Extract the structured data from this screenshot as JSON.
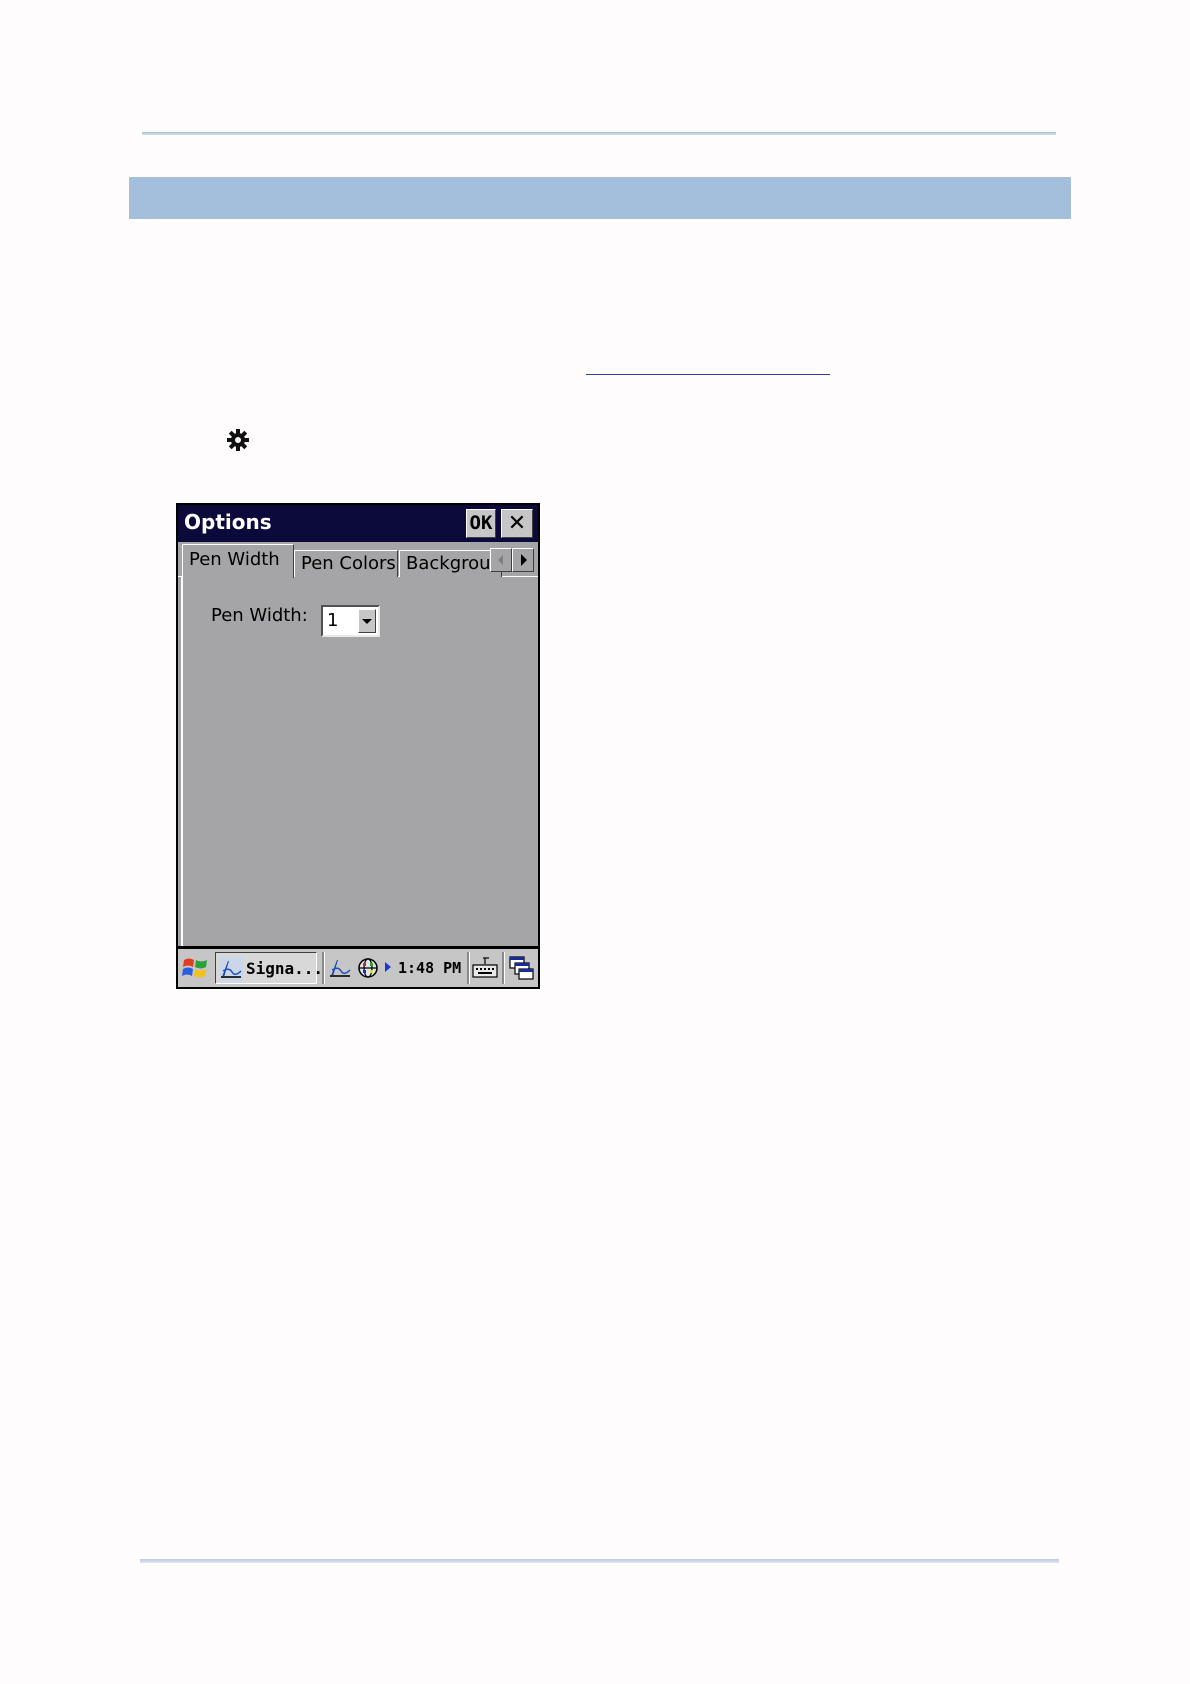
{
  "dialog": {
    "title": "Options",
    "ok_label": "OK",
    "close_label": "✕"
  },
  "tabs": [
    {
      "label": "Pen Width",
      "active": true
    },
    {
      "label": "Pen Colors",
      "active": false
    },
    {
      "label": "Backgroun",
      "active": false
    }
  ],
  "pen_width": {
    "label": "Pen Width:",
    "value": "1"
  },
  "taskbar": {
    "task_label": "Signa...",
    "clock": "1:48 PM"
  },
  "colors": {
    "title_bar": "#0b0a3b",
    "dialog_bg": "#a5a4a6",
    "section_bar": "#a3bfdc",
    "taskbar": "#c6c6c6"
  },
  "icons": [
    "gear-icon",
    "windows-start-icon",
    "signature-pen-icon",
    "network-globe-icon",
    "keyboard-icon",
    "desktop-windows-icon"
  ]
}
